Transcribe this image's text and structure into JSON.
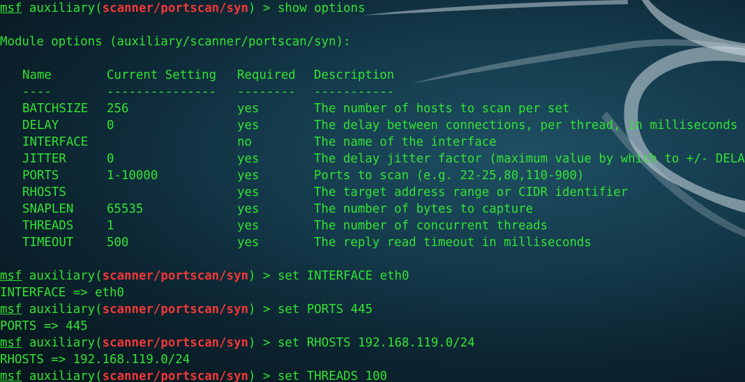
{
  "colors": {
    "terminal_text": "#33e233",
    "module_name": "#f23838",
    "background": "#143a4b"
  },
  "prompt": {
    "msf": "msf",
    "type": "auxiliary",
    "module": "scanner/portscan/syn",
    "suffix": ">"
  },
  "commands": {
    "show_options": "show options",
    "set_interface": "set INTERFACE eth0",
    "set_ports": "set PORTS 445",
    "set_rhosts": "set RHOSTS 192.168.119.0/24",
    "set_threads": "set THREADS 100"
  },
  "module_options_heading": "Module options (auxiliary/scanner/portscan/syn):",
  "table": {
    "headers": [
      "Name",
      "Current Setting",
      "Required",
      "Description"
    ],
    "separators": [
      "----",
      "---------------",
      "--------",
      "-----------"
    ],
    "rows": [
      [
        "BATCHSIZE",
        "256",
        "yes",
        "The number of hosts to scan per set"
      ],
      [
        "DELAY",
        "0",
        "yes",
        "The delay between connections, per thread, in milliseconds"
      ],
      [
        "INTERFACE",
        "",
        "no",
        "The name of the interface"
      ],
      [
        "JITTER",
        "0",
        "yes",
        "The delay jitter factor (maximum value by which to +/- DELAY) in milliseconds."
      ],
      [
        "PORTS",
        "1-10000",
        "yes",
        "Ports to scan (e.g. 22-25,80,110-900)"
      ],
      [
        "RHOSTS",
        "",
        "yes",
        "The target address range or CIDR identifier"
      ],
      [
        "SNAPLEN",
        "65535",
        "yes",
        "The number of bytes to capture"
      ],
      [
        "THREADS",
        "1",
        "yes",
        "The number of concurrent threads"
      ],
      [
        "TIMEOUT",
        "500",
        "yes",
        "The reply read timeout in milliseconds"
      ]
    ]
  },
  "outputs": {
    "interface": "INTERFACE => eth0",
    "ports": "PORTS => 445",
    "rhosts": "RHOSTS => 192.168.119.0/24"
  }
}
